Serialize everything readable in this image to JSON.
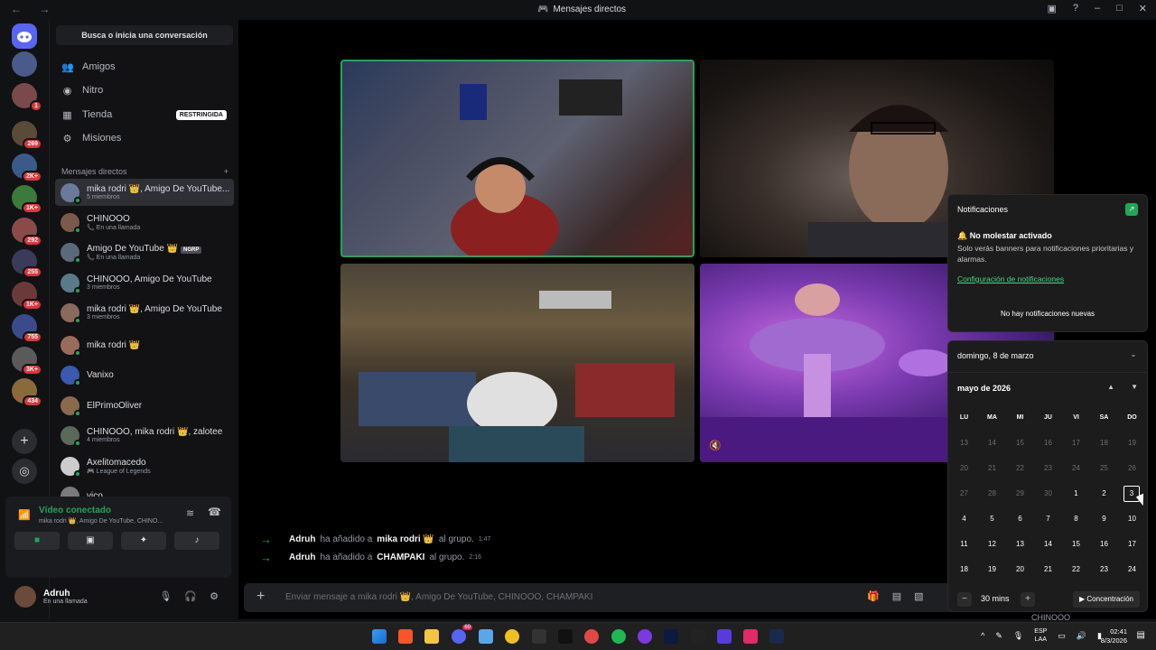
{
  "window": {
    "title": "Mensajes directos"
  },
  "servers": [
    {
      "badge": ""
    },
    {
      "badge": "1"
    },
    {
      "badge": "269"
    },
    {
      "badge": "2K+"
    },
    {
      "badge": "1K+"
    },
    {
      "badge": "292"
    },
    {
      "badge": "255"
    },
    {
      "badge": "1K+"
    },
    {
      "badge": "755"
    },
    {
      "badge": "3K+"
    },
    {
      "badge": "434"
    }
  ],
  "sidebar": {
    "search_label": "Busca o inicia una conversación",
    "nav": [
      {
        "label": "Amigos",
        "icon": "friends-icon"
      },
      {
        "label": "Nitro",
        "icon": "nitro-icon"
      },
      {
        "label": "Tienda",
        "icon": "shop-icon",
        "tag": "RESTRINGIDA"
      },
      {
        "label": "Misiones",
        "icon": "quests-icon"
      }
    ],
    "dm_header": "Mensajes directos",
    "dms": [
      {
        "name": "mika rodri 👑, Amigo De YouTube...",
        "sub": "5 miembros",
        "selected": true
      },
      {
        "name": "CHINOOO",
        "sub": "📞 En una llamada"
      },
      {
        "name": "Amigo De YouTube 👑",
        "tag": "NGRP",
        "sub": "📞 En una llamada"
      },
      {
        "name": "CHINOOO, Amigo De YouTube",
        "sub": "3 miembros"
      },
      {
        "name": "mika rodri 👑, Amigo De YouTube",
        "sub": "3 miembros"
      },
      {
        "name": "mika rodri 👑",
        "sub": ""
      },
      {
        "name": "Vanixo",
        "sub": ""
      },
      {
        "name": "ElPrimoOliver",
        "sub": ""
      },
      {
        "name": "CHINOOO, mika rodri 👑, zalotee",
        "sub": "4 miembros"
      },
      {
        "name": "Axelitomacedo",
        "sub": "🎮 League of Legends"
      },
      {
        "name": "vico",
        "sub": ""
      }
    ]
  },
  "voice": {
    "status": "Vídeo conectado",
    "channel": "mika rodri 👑, Amigo De YouTube, CHINO..."
  },
  "user": {
    "name": "Adruh",
    "status": "En una llamada"
  },
  "chat": {
    "events": [
      {
        "actor": "Adruh",
        "verb": "ha añadido a",
        "target": "mika rodri 👑",
        "suffix": "al grupo.",
        "time": "1:47"
      },
      {
        "actor": "Adruh",
        "verb": "ha añadido a",
        "target": "CHAMPAKI",
        "suffix": "al grupo.",
        "time": "2:16"
      }
    ],
    "placeholder": "Enviar mensaje a mika rodri 👑, Amigo De YouTube, CHINOOO, CHAMPAKI"
  },
  "notifications": {
    "title": "Notificaciones",
    "dnd_title": "No molestar activado",
    "dnd_text": "Solo verás banners para notificaciones prioritarias y alarmas.",
    "settings_link": "Configuración de notificaciones",
    "empty": "No hay notificaciones nuevas"
  },
  "calendar": {
    "date_label": "domingo, 8 de marzo",
    "month": "mayo de 2026",
    "weekdays": [
      "LU",
      "MA",
      "MI",
      "JU",
      "VI",
      "SA",
      "DO"
    ],
    "weeks": [
      [
        "13",
        "14",
        "15",
        "16",
        "17",
        "18",
        "19"
      ],
      [
        "20",
        "21",
        "22",
        "23",
        "24",
        "25",
        "26"
      ],
      [
        "27",
        "28",
        "29",
        "30",
        "1",
        "2",
        "3"
      ],
      [
        "4",
        "5",
        "6",
        "7",
        "8",
        "9",
        "10"
      ],
      [
        "11",
        "12",
        "13",
        "14",
        "15",
        "16",
        "17"
      ],
      [
        "18",
        "19",
        "20",
        "21",
        "22",
        "23",
        "24"
      ]
    ],
    "focus_minutes": "30 mins",
    "focus_button": "Concentración"
  },
  "taskbar": {
    "lang_top": "ESP",
    "lang_bottom": "LAA",
    "time": "02:41",
    "date": "8/3/2026",
    "discord_badge": "69"
  },
  "partial_name": "CHINOOO"
}
